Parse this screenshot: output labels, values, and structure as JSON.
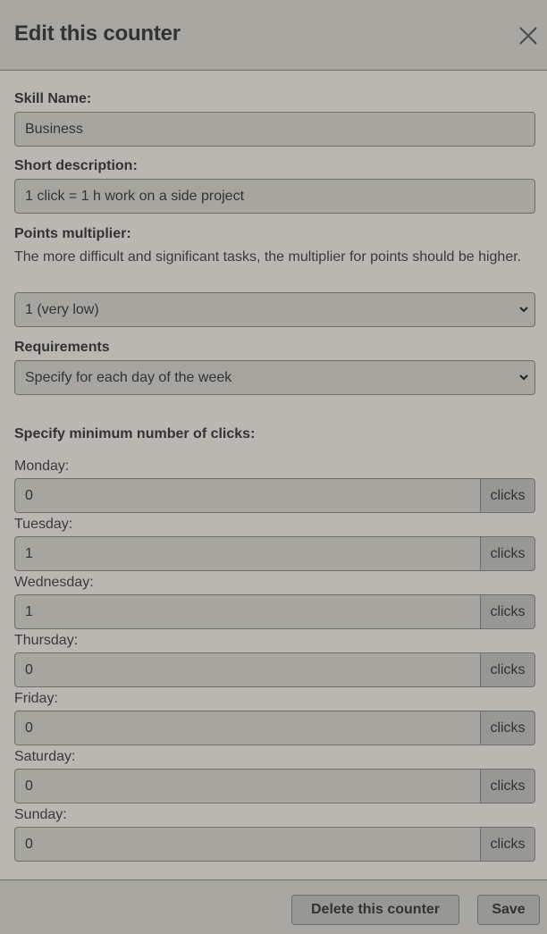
{
  "modal": {
    "title": "Edit this counter",
    "close_icon": "close-icon"
  },
  "form": {
    "skill_name": {
      "label": "Skill Name:",
      "value": "Business"
    },
    "short_description": {
      "label": "Short description:",
      "value": "1 click = 1 h work on a side project"
    },
    "points_multiplier": {
      "label": "Points multiplier:",
      "help": "The more difficult and significant tasks, the multiplier for points should be higher.",
      "selected": "1 (very low)"
    },
    "requirements": {
      "label": "Requirements",
      "selected": "Specify for each day of the week"
    },
    "min_clicks": {
      "heading": "Specify minimum number of clicks:",
      "unit": "clicks",
      "days": [
        {
          "label": "Monday:",
          "value": "0"
        },
        {
          "label": "Tuesday:",
          "value": "1"
        },
        {
          "label": "Wednesday:",
          "value": "1"
        },
        {
          "label": "Thursday:",
          "value": "0"
        },
        {
          "label": "Friday:",
          "value": "0"
        },
        {
          "label": "Saturday:",
          "value": "0"
        },
        {
          "label": "Sunday:",
          "value": "0"
        }
      ]
    }
  },
  "footer": {
    "delete_label": "Delete this counter",
    "save_label": "Save"
  }
}
